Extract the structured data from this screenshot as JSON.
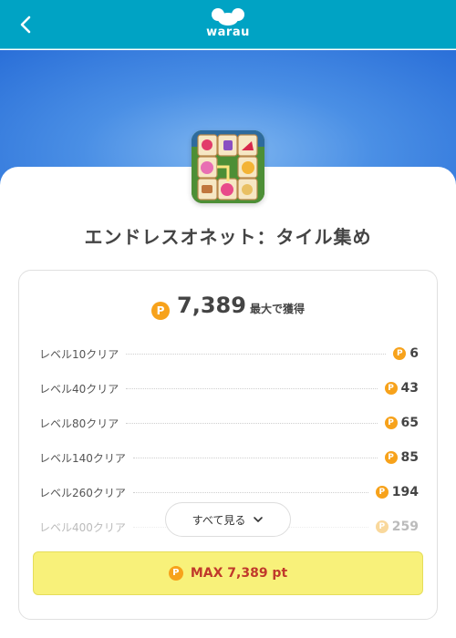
{
  "header": {
    "logo_text": "warau",
    "back_icon": "chevron-left-icon",
    "bg_color": "#00a3c4"
  },
  "app": {
    "title": "エンドレスオネット：タイル集め",
    "icon": "mahjong-tiles-app-icon"
  },
  "summary": {
    "coin_symbol": "P",
    "total_points": "7,389",
    "suffix": "最大で獲得"
  },
  "rewards": [
    {
      "label": "レベル10クリア",
      "points": "6"
    },
    {
      "label": "レベル40クリア",
      "points": "43"
    },
    {
      "label": "レベル80クリア",
      "points": "65"
    },
    {
      "label": "レベル140クリア",
      "points": "85"
    },
    {
      "label": "レベル260クリア",
      "points": "194"
    },
    {
      "label": "レベル400クリア",
      "points": "259"
    }
  ],
  "see_all": {
    "label": "すべて見る",
    "icon": "chevron-down-icon"
  },
  "max_button": {
    "label": "MAX 7,389 pt",
    "bg_color": "#f8f17a",
    "text_color": "#c0392b"
  },
  "colors": {
    "coin": "#f7a21b",
    "hero_blue": "#4a8fe5"
  }
}
